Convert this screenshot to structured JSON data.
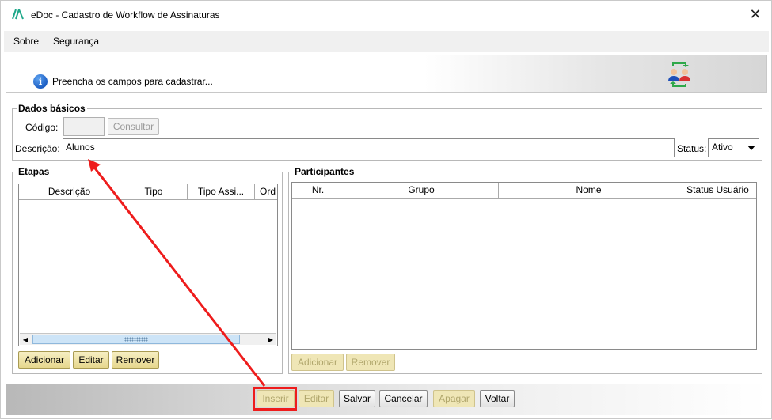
{
  "window": {
    "title": "eDoc - Cadastro de Workflow de Assinaturas",
    "close_glyph": "✕"
  },
  "menu": {
    "items": [
      {
        "label": "Sobre"
      },
      {
        "label": "Segurança"
      }
    ]
  },
  "banner": {
    "info_glyph": "i",
    "message": "Preencha os campos para cadastrar..."
  },
  "basic": {
    "legend": "Dados básicos",
    "code_label": "Código:",
    "code_value": "",
    "consult_button": "Consultar",
    "description_label": "Descrição:",
    "description_value": "Alunos",
    "status_label": "Status:",
    "status_value": "Ativo"
  },
  "steps": {
    "legend": "Etapas",
    "columns": [
      "Descrição",
      "Tipo",
      "Tipo Assi...",
      "Ord"
    ],
    "rows": [],
    "buttons": {
      "add": "Adicionar",
      "edit": "Editar",
      "remove": "Remover"
    }
  },
  "participants": {
    "legend": "Participantes",
    "columns": [
      "Nr.",
      "Grupo",
      "Nome",
      "Status Usuário"
    ],
    "rows": [],
    "buttons": {
      "add": "Adicionar",
      "remove": "Remover"
    }
  },
  "actions": {
    "insert": "Inserir",
    "edit": "Editar",
    "save": "Salvar",
    "cancel": "Cancelar",
    "delete": "Apagar",
    "back": "Voltar"
  },
  "colors": {
    "annotation": "#ee1c1c",
    "gold_button": "#e6d78d",
    "accent": "#1d5fc4"
  }
}
